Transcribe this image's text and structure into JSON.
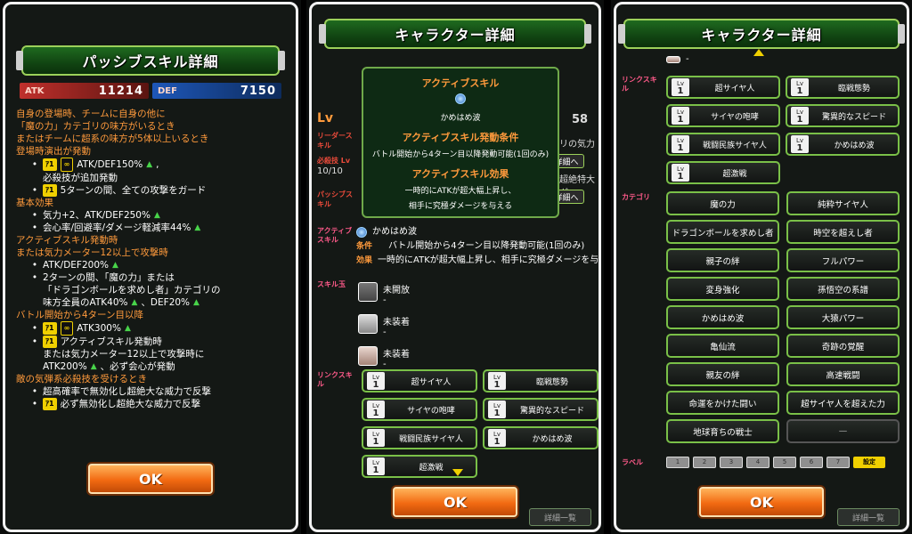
{
  "panel1": {
    "title": "パッシブスキル詳細",
    "atk_label": "ATK",
    "atk_value": "11214",
    "def_label": "DEF",
    "def_value": "7150",
    "lines": {
      "l1": "自身の登場時、チームに自身の他に",
      "l2": "「魔の力」カテゴリの味方がいるとき",
      "l3": "またはチームに超系の味方が5体以上いるとき",
      "l4": "登場時演出が発動",
      "l5": "ATK/DEF150%",
      "l6": "必殺技が追加発動",
      "l7": "5ターンの間、全ての攻撃をガード",
      "l8": "基本効果",
      "l9": "気力+2、ATK/DEF250%",
      "l10": "会心率/回避率/ダメージ軽減率44%",
      "l11": "アクティブスキル発動時",
      "l12": "または気力メーター12以上で攻撃時",
      "l13": "ATK/DEF200%",
      "l14": "2ターンの間、「魔の力」または",
      "l15": "「ドラゴンボールを求めし者」カテゴリの",
      "l16": "味方全員のATK40%",
      "l16b": "、DEF20%",
      "l17": "バトル開始から4ターン目以降",
      "l18": "ATK300%",
      "l19": "アクティブスキル発動時",
      "l20": "または気力メーター12以上で攻撃時に",
      "l21": "ATK200%",
      "l21b": "、必ず会心が発動",
      "l22": "敵の気弾系必殺技を受けるとき",
      "l23": "超高確率で無効化し超絶大な威力で反撃",
      "l24": "必ず無効化し超絶大な威力で反撃"
    },
    "tag_1": "ｱ1",
    "tag_inf": "∞",
    "ok": "OK"
  },
  "panel2": {
    "title": "キャラクター詳細",
    "popup": {
      "h1": "アクティブスキル",
      "name": "かめはめ波",
      "h2": "アクティブスキル発動条件",
      "cond": "バトル開始から4ターン目以降発動可能(1回のみ)",
      "h3": "アクティブスキル効果",
      "eff1": "一時的にATKが超大幅上昇し、",
      "eff2": "相手に究極ダメージを与える"
    },
    "bg_level_label": "Lv",
    "bg_leader_label": "リーダースキル",
    "bg_skill_lv_label": "必殺技 Lv",
    "bg_skill_lv_value": "10/10",
    "bg_passive_label": "パッシブスキル",
    "bg_cost_value": "58",
    "bg_leader_text": "リの気力",
    "bg_special_text": "超絶特大ダ",
    "detail_btn": "詳細へ",
    "active_label": "アクティブスキル",
    "active_name": "かめはめ波",
    "cond_label": "条件",
    "cond_text": "バトル開始から4ターン目以降発動可能(1回のみ)",
    "eff_label": "効果",
    "eff_text": "一時的にATKが超大幅上昇し、相手に究極ダメージを与",
    "orb_label": "スキル玉",
    "orbs": [
      {
        "name": "未開放",
        "sub": "-"
      },
      {
        "name": "未装着",
        "sub": "-"
      },
      {
        "name": "未装着",
        "sub": "-"
      }
    ],
    "link_label": "リンクスキル",
    "links": [
      "超サイヤ人",
      "臨戦態勢",
      "サイヤの咆哮",
      "驚異的なスピード",
      "戦闘民族サイヤ人",
      "かめはめ波",
      "超激戦"
    ],
    "lv_label": "Lv",
    "lv_value": "1",
    "ok": "OK",
    "bottom_right": "詳細一覧"
  },
  "panel3": {
    "title": "キャラクター詳細",
    "link_label": "リンクスキル",
    "top_dash": "-",
    "links": [
      "超サイヤ人",
      "臨戦態勢",
      "サイヤの咆哮",
      "驚異的なスピード",
      "戦闘民族サイヤ人",
      "かめはめ波",
      "超激戦"
    ],
    "category_label": "カテゴリ",
    "categories": [
      "魔の力",
      "純粋サイヤ人",
      "ドラゴンボールを求めし者",
      "時空を超えし者",
      "親子の絆",
      "フルパワー",
      "変身強化",
      "孫悟空の系譜",
      "かめはめ波",
      "大猿パワー",
      "亀仙流",
      "奇跡の覚醒",
      "親友の絆",
      "高速戦闘",
      "命運をかけた闘い",
      "超サイヤ人を超えた力",
      "地球育ちの戦士",
      "—"
    ],
    "label_label": "ラベル",
    "label_nums": [
      "1",
      "2",
      "3",
      "4",
      "5",
      "6",
      "7"
    ],
    "label_set": "設定",
    "ok": "OK",
    "bottom_right": "詳細一覧"
  },
  "help_icon_text": "?"
}
